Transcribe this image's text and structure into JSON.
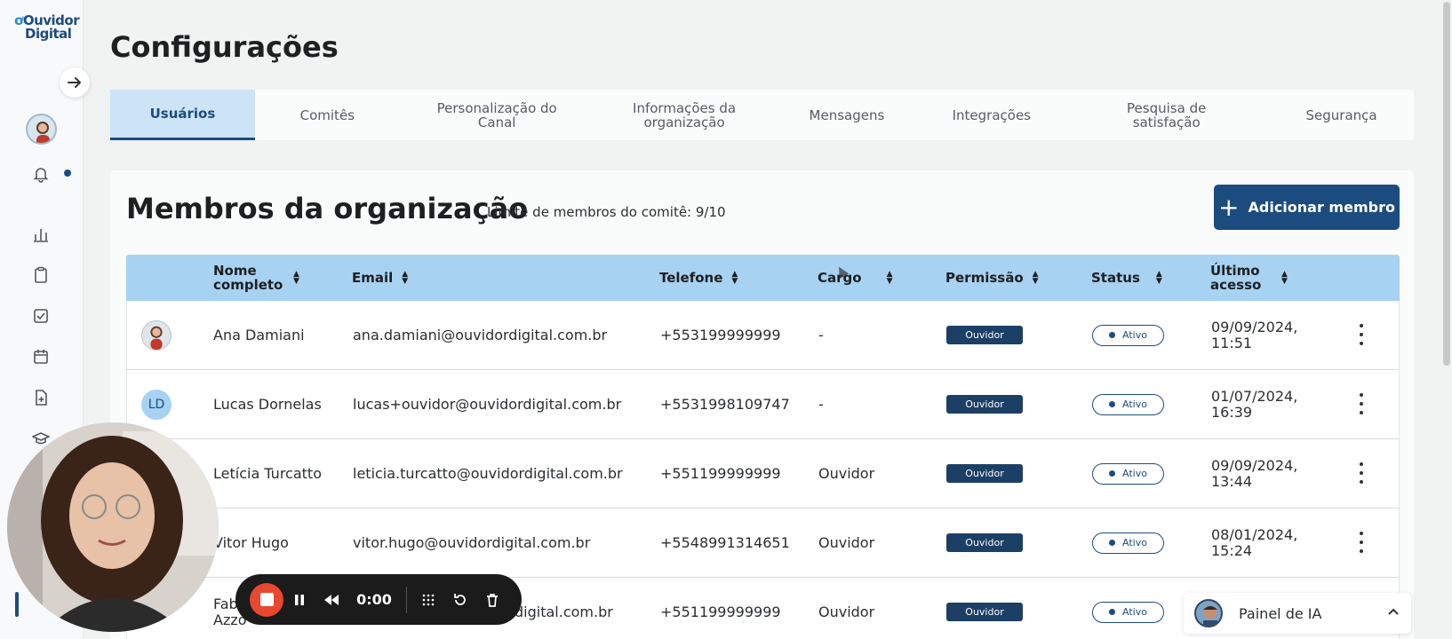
{
  "sidebar": {
    "logo_line1": "Ouvidor",
    "logo_line2": "Digital",
    "icons": [
      "arrow-right-icon",
      "user-avatar",
      "bell-icon",
      "chart-icon",
      "clipboard-icon",
      "checkbox-icon",
      "calendar-icon",
      "file-plus-icon",
      "graduation-cap-icon",
      "gear-icon"
    ]
  },
  "page": {
    "title": "Configurações"
  },
  "tabs": [
    {
      "label": "Usuários",
      "active": true
    },
    {
      "label": "Comitês"
    },
    {
      "label": "Personalização do Canal"
    },
    {
      "label": "Informações da organização"
    },
    {
      "label": "Mensagens"
    },
    {
      "label": "Integrações"
    },
    {
      "label": "Pesquisa de satisfação"
    },
    {
      "label": "Segurança"
    }
  ],
  "members": {
    "title": "Membros da organização",
    "limit_text": "Limite de membros do comitê: 9/10",
    "add_button": "Adicionar membro",
    "columns": [
      "Nome completo",
      "Email",
      "Telefone",
      "Cargo",
      "Permissão",
      "Status",
      "Último acesso"
    ],
    "rows": [
      {
        "avatar": "photo",
        "initials": "",
        "name": "Ana Damiani",
        "email": "ana.damiani@ouvidordigital.com.br",
        "phone": "+553199999999",
        "role": "-",
        "permission": "Ouvidor",
        "status": "Ativo",
        "last_access_1": "09/09/2024,",
        "last_access_2": "11:51"
      },
      {
        "avatar": "initials",
        "initials": "LD",
        "name": "Lucas Dornelas",
        "email": "lucas+ouvidor@ouvidordigital.com.br",
        "phone": "+5531998109747",
        "role": "-",
        "permission": "Ouvidor",
        "status": "Ativo",
        "last_access_1": "01/07/2024,",
        "last_access_2": "16:39"
      },
      {
        "avatar": "",
        "initials": "",
        "name": "Letícia Turcatto",
        "email": "leticia.turcatto@ouvidordigital.com.br",
        "phone": "+551199999999",
        "role": "Ouvidor",
        "permission": "Ouvidor",
        "status": "Ativo",
        "last_access_1": "09/09/2024,",
        "last_access_2": "13:44"
      },
      {
        "avatar": "",
        "initials": "",
        "name": "Vitor Hugo",
        "email": "vitor.hugo@ouvidordigital.com.br",
        "phone": "+5548991314651",
        "role": "Ouvidor",
        "permission": "Ouvidor",
        "status": "Ativo",
        "last_access_1": "08/01/2024,",
        "last_access_2": "15:24"
      },
      {
        "avatar": "",
        "initials": "",
        "name": "Fab",
        "name_2": "Azzo",
        "email": "digital.com.br",
        "phone": "+551199999999",
        "role": "Ouvidor",
        "permission": "Ouvidor",
        "status": "Ativo",
        "last_access_1": "",
        "last_access_2": ""
      }
    ]
  },
  "recorder": {
    "time": "0:00"
  },
  "ai_panel": {
    "label": "Painel de IA"
  },
  "colors": {
    "primary": "#1c4c7f",
    "header_bg": "#a7d2f2",
    "tab_active_bg": "#cce4f6",
    "record": "#e8482f"
  }
}
